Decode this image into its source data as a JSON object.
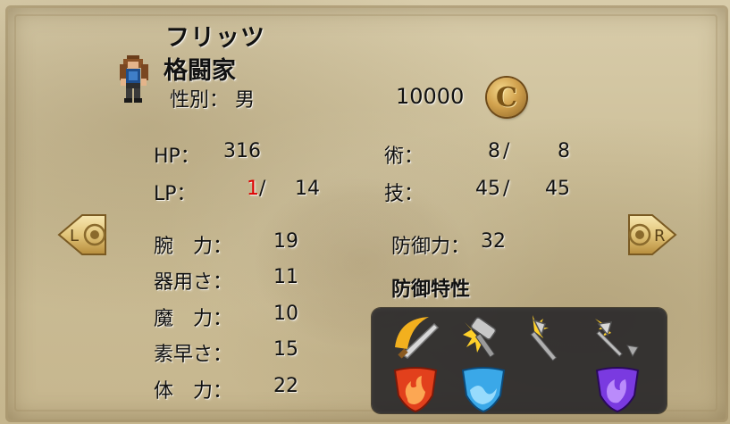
{
  "character": {
    "name": "フリッツ",
    "class": "格闘家",
    "gender_label": "性別：",
    "gender": "男",
    "sprite_icon": "fighter-sprite-icon"
  },
  "money": {
    "amount": "10000",
    "coin_letter": "C",
    "icon": "gold-coin-icon"
  },
  "stats": {
    "hp_label": "HP：",
    "hp": "316",
    "lp_label": "LP：",
    "lp_current": "1",
    "lp_sep": "/",
    "lp_max": "14",
    "jutsu_label": "術：",
    "jutsu_current": "8",
    "jutsu_sep": "/",
    "jutsu_max": "8",
    "waza_label": "技：",
    "waza_current": "45",
    "waza_sep": "/",
    "waza_max": "45",
    "strength_label": "腕　力：",
    "strength": "19",
    "dexterity_label": "器用さ：",
    "dexterity": "11",
    "magic_label": "魔　力：",
    "magic": "10",
    "agility_label": "素早さ：",
    "agility": "15",
    "stamina_label": "体　力：",
    "stamina": "22",
    "defense_label": "防御力：",
    "defense": "32",
    "resist_label": "防御特性"
  },
  "nav": {
    "left_letter": "L",
    "right_letter": "R"
  },
  "resistances": {
    "row1": [
      "slash-icon",
      "blunt-icon",
      "pierce-icon",
      "projectile-icon"
    ],
    "row2": [
      "fire-shield-icon",
      "water-shield-icon",
      "dark-shield-icon"
    ]
  },
  "colors": {
    "lp_current": "#dd0000",
    "fire": "#e2401c",
    "water": "#3aa8e8",
    "dark": "#7a3ae0",
    "gold": "#d8a24a"
  }
}
